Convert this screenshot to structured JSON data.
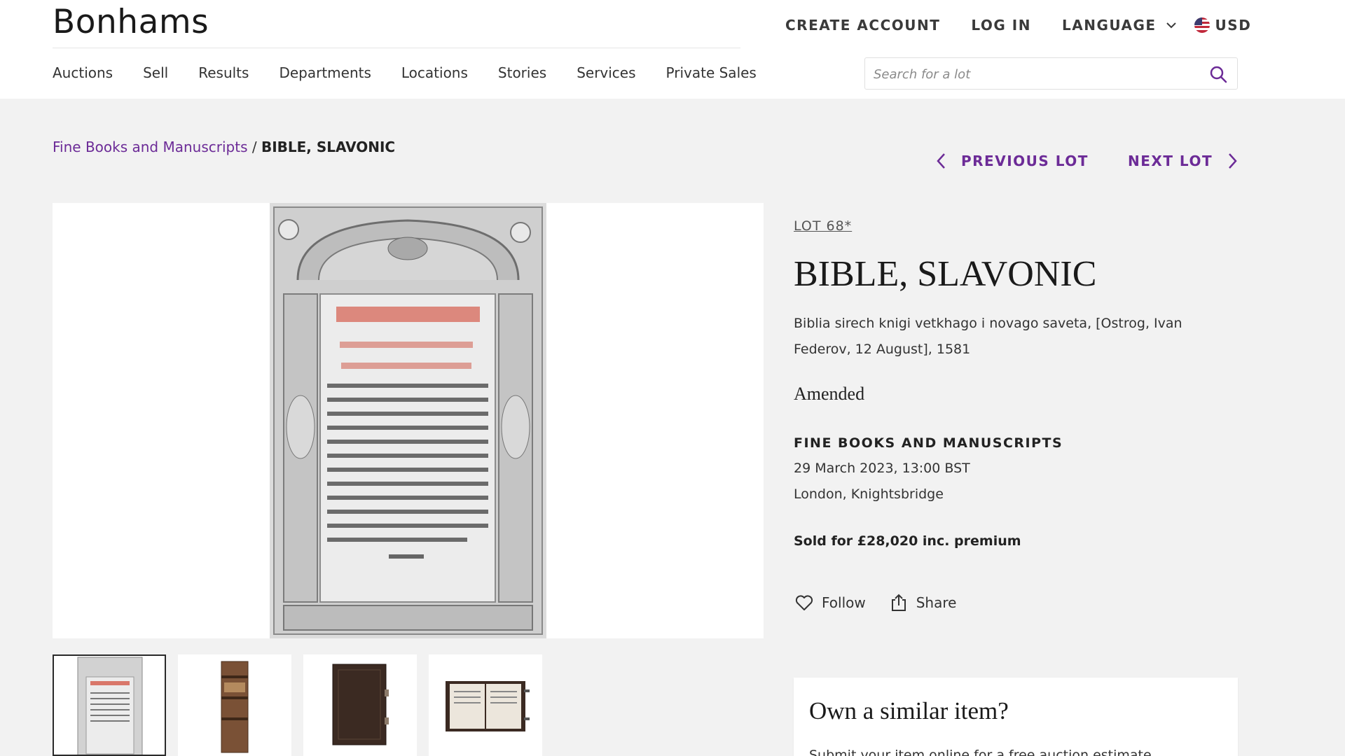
{
  "header": {
    "logo": "Bonhams",
    "top_links": {
      "create_account": "CREATE ACCOUNT",
      "log_in": "LOG IN",
      "language": "LANGUAGE",
      "currency": "USD"
    },
    "nav": [
      "Auctions",
      "Sell",
      "Results",
      "Departments",
      "Locations",
      "Stories",
      "Services",
      "Private Sales"
    ],
    "search_placeholder": "Search for a lot"
  },
  "breadcrumb": {
    "link": "Fine Books and Manuscripts",
    "separator": " / ",
    "current": "BIBLE, SLAVONIC"
  },
  "lot_nav": {
    "previous": "PREVIOUS LOT",
    "next": "NEXT LOT"
  },
  "lot": {
    "number": "LOT 68*",
    "title": "BIBLE, SLAVONIC",
    "description": "Biblia sirech knigi vetkhago i novago saveta, [Ostrog, Ivan Federov, 12 August], 1581",
    "amended": "Amended",
    "sale_name": "FINE BOOKS AND MANUSCRIPTS",
    "sale_date": "29 March 2023, 13:00 BST",
    "sale_location": "London, Knightsbridge",
    "sold_for": "Sold for £28,020 inc. premium",
    "actions": {
      "follow": "Follow",
      "share": "Share"
    }
  },
  "gallery": {
    "thumbnails": [
      "title-page",
      "book-spine",
      "book-cover",
      "book-open"
    ],
    "active_index": 0
  },
  "similar": {
    "title": "Own a similar item?",
    "text": "Submit your item online for a free auction estimate."
  },
  "colors": {
    "accent": "#6c2b97",
    "page_bg": "#f2f2f2"
  }
}
